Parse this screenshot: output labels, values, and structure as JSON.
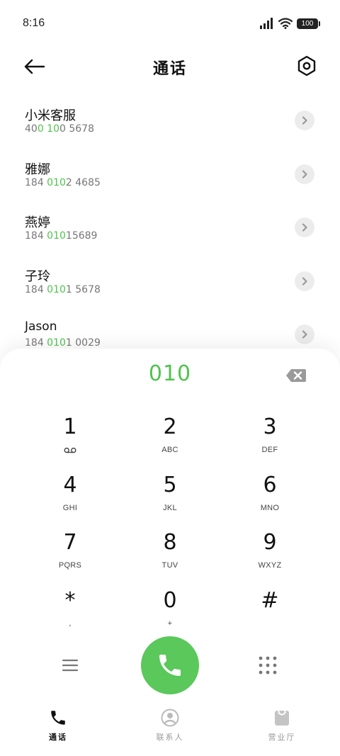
{
  "status_bar": {
    "time": "8:16",
    "battery": "100"
  },
  "header": {
    "title": "通话"
  },
  "contacts": [
    {
      "name": "小米客服",
      "number_parts": [
        "40",
        "0 10",
        "0 5678"
      ]
    },
    {
      "name": "雅娜",
      "number_parts": [
        "184 ",
        "010",
        "2 4685"
      ]
    },
    {
      "name": "燕婷",
      "number_parts": [
        "184 ",
        "010",
        "15689"
      ]
    },
    {
      "name": "子玲",
      "number_parts": [
        "184 ",
        "010",
        "1 5678"
      ]
    },
    {
      "name": "Jason",
      "number_parts": [
        "184 ",
        "010",
        "1 0029"
      ]
    }
  ],
  "dialpad": {
    "dialed_number": "010",
    "keys": [
      {
        "digit": "1",
        "letters": "",
        "sub_icon": "voicemail-icon"
      },
      {
        "digit": "2",
        "letters": "ABC"
      },
      {
        "digit": "3",
        "letters": "DEF"
      },
      {
        "digit": "4",
        "letters": "GHI"
      },
      {
        "digit": "5",
        "letters": "JKL"
      },
      {
        "digit": "6",
        "letters": "MNO"
      },
      {
        "digit": "7",
        "letters": "PQRS"
      },
      {
        "digit": "8",
        "letters": "TUV"
      },
      {
        "digit": "9",
        "letters": "WXYZ"
      },
      {
        "digit": "*",
        "letters": ","
      },
      {
        "digit": "0",
        "letters": "+"
      },
      {
        "digit": "#",
        "letters": ""
      }
    ]
  },
  "bottom_nav": [
    {
      "label": "通话",
      "icon": "phone-icon",
      "active": true
    },
    {
      "label": "联系人",
      "icon": "person-icon",
      "active": false
    },
    {
      "label": "营业厅",
      "icon": "shopping-bag-icon",
      "active": false
    }
  ],
  "colors": {
    "accent": "#4fc44d",
    "call_button": "#5ac85a",
    "detail_button": "#ececec"
  }
}
